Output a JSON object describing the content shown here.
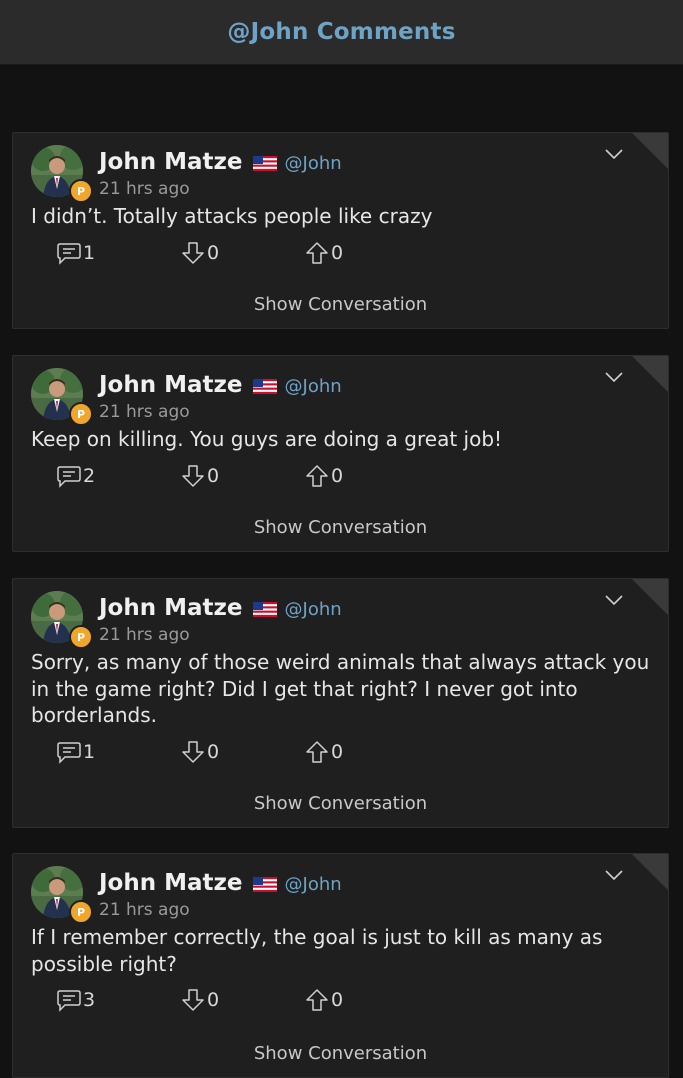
{
  "header": {
    "title": "@John Comments"
  },
  "comments": [
    {
      "author": "John Matze",
      "handle": "@John",
      "time": "21 hrs ago",
      "text": "I didn’t. Totally attacks people like crazy",
      "replies": "1",
      "downvotes": "0",
      "upvotes": "0",
      "show_label": "Show Conversation"
    },
    {
      "author": "John Matze",
      "handle": "@John",
      "time": "21 hrs ago",
      "text": "Keep on killing. You guys are doing a great job!",
      "replies": "2",
      "downvotes": "0",
      "upvotes": "0",
      "show_label": "Show Conversation"
    },
    {
      "author": "John Matze",
      "handle": "@John",
      "time": "21 hrs ago",
      "text": "Sorry, as many of those weird animals that always attack you in the game right? Did I get that right? I never got into borderlands.",
      "replies": "1",
      "downvotes": "0",
      "upvotes": "0",
      "show_label": "Show Conversation"
    },
    {
      "author": "John Matze",
      "handle": "@John",
      "time": "21 hrs ago",
      "text": "If I remember correctly, the goal is just to kill as many as possible right?",
      "replies": "3",
      "downvotes": "0",
      "upvotes": "0",
      "show_label": "Show Conversation"
    }
  ],
  "icons": {
    "reply": "comment-icon",
    "downvote": "downvote-arrow-icon",
    "upvote": "upvote-arrow-icon",
    "menu": "chevron-down-icon",
    "flag": "us-flag-icon",
    "badge": "parler-badge-icon"
  },
  "colors": {
    "accent": "#6fa3c6",
    "badge": "#f0a62a",
    "background": "#121212",
    "card": "#1f1f1f"
  }
}
